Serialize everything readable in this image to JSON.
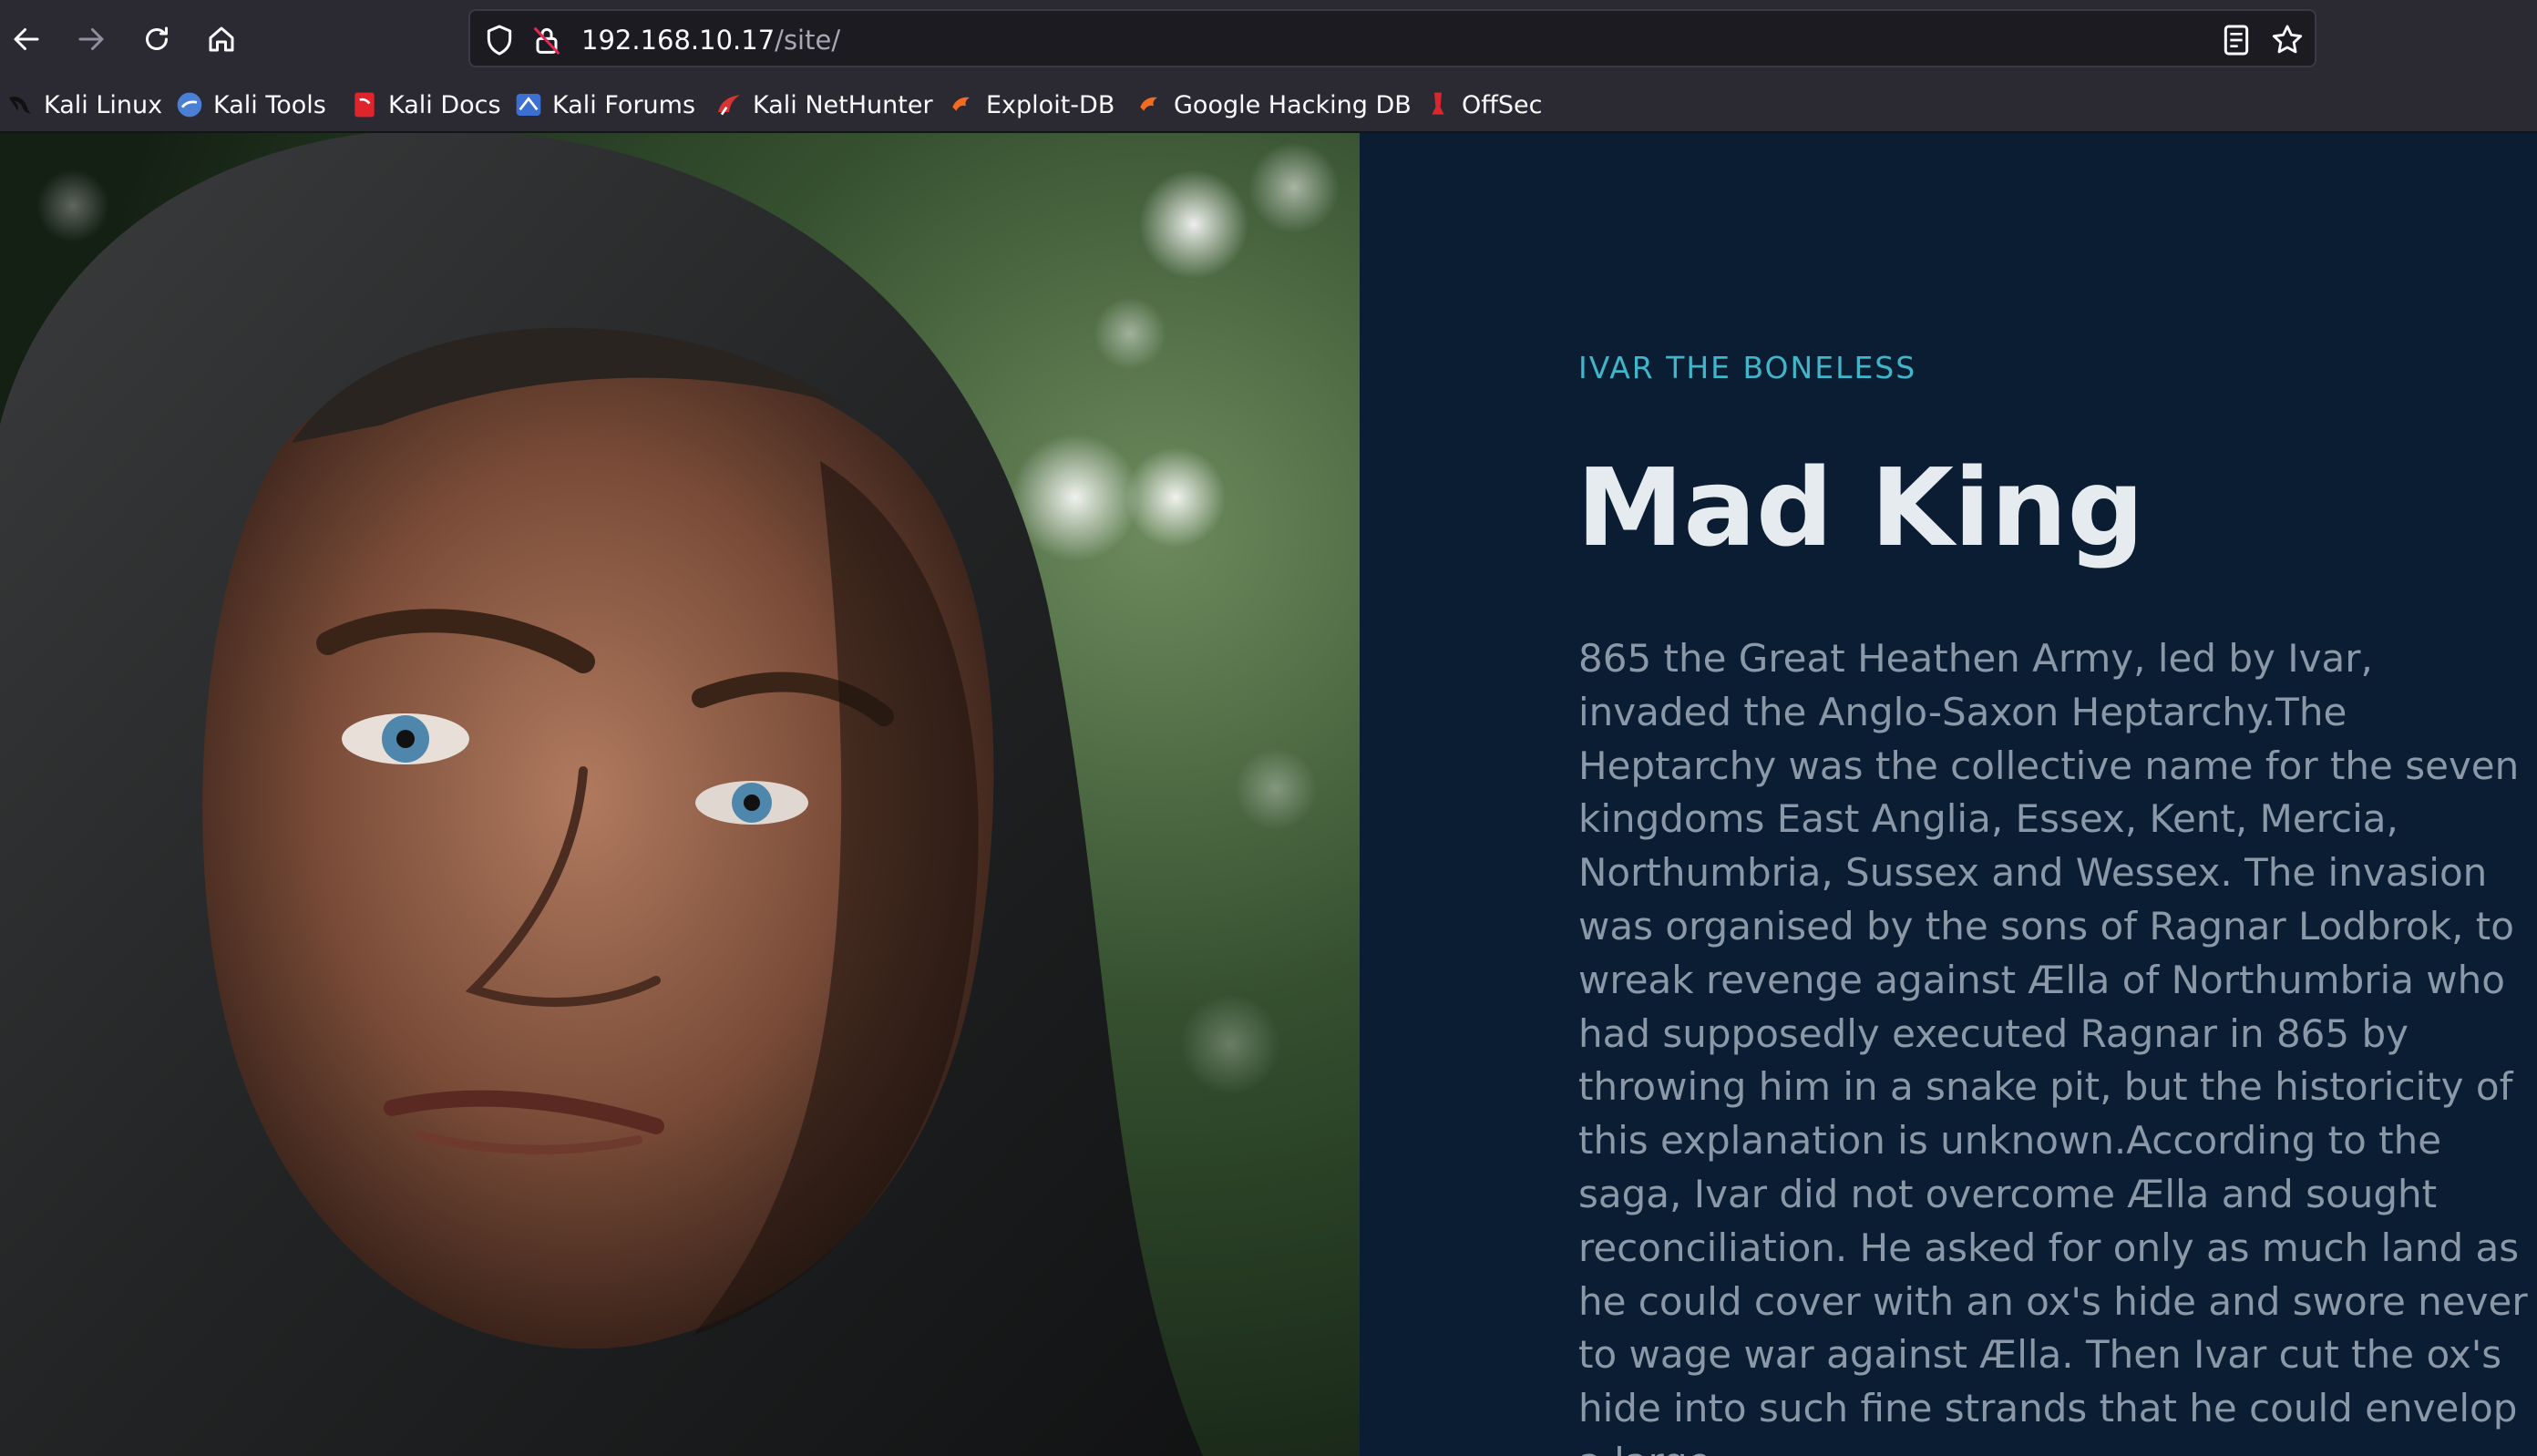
{
  "browser": {
    "url_host": "192.168.10.17",
    "url_path": "/site/",
    "back_icon": "arrow-left-icon",
    "forward_icon": "arrow-right-icon",
    "reload_icon": "reload-icon",
    "home_icon": "home-icon",
    "bookmarks": [
      {
        "label": "Kali Linux",
        "icon": "kali-dragon-icon",
        "color": "#1a1a1a"
      },
      {
        "label": "Kali Tools",
        "icon": "kali-tools-icon",
        "color": "#4a7fd4"
      },
      {
        "label": "Kali Docs",
        "icon": "kali-docs-icon",
        "color": "#e0242c"
      },
      {
        "label": "Kali Forums",
        "icon": "kali-forums-icon",
        "color": "#3b6fd1"
      },
      {
        "label": "Kali NetHunter",
        "icon": "nethunter-icon",
        "color": "#d93434"
      },
      {
        "label": "Exploit-DB",
        "icon": "exploit-db-icon",
        "color": "#f26b21"
      },
      {
        "label": "Google Hacking DB",
        "icon": "ghdb-icon",
        "color": "#f26b21"
      },
      {
        "label": "OffSec",
        "icon": "offsec-icon",
        "color": "#d6282e"
      }
    ]
  },
  "page": {
    "eyebrow": "IVAR THE BONELESS",
    "title": "Mad King",
    "body": "865 the Great Heathen Army, led by Ivar, invaded the Anglo-Saxon Heptarchy.The Heptarchy was the collective name for the seven kingdoms East Anglia, Essex, Kent, Mercia, Northumbria, Sussex and Wessex. The invasion was organised by the sons of Ragnar Lodbrok, to wreak revenge against Ælla of Northumbria who had supposedly executed Ragnar in 865 by throwing him in a snake pit, but the historicity of this explanation is unknown.According to the saga, Ivar did not overcome Ælla and sought reconciliation. He asked for only as much land as he could cover with an ox's hide and swore never to wage war against Ælla. Then Ivar cut the ox's hide into such fine strands that he could envelop a large",
    "colors": {
      "background": "#0b1d33",
      "accent": "#3fb6c9",
      "heading": "#e6ebf0",
      "body": "#8b98a7"
    }
  }
}
